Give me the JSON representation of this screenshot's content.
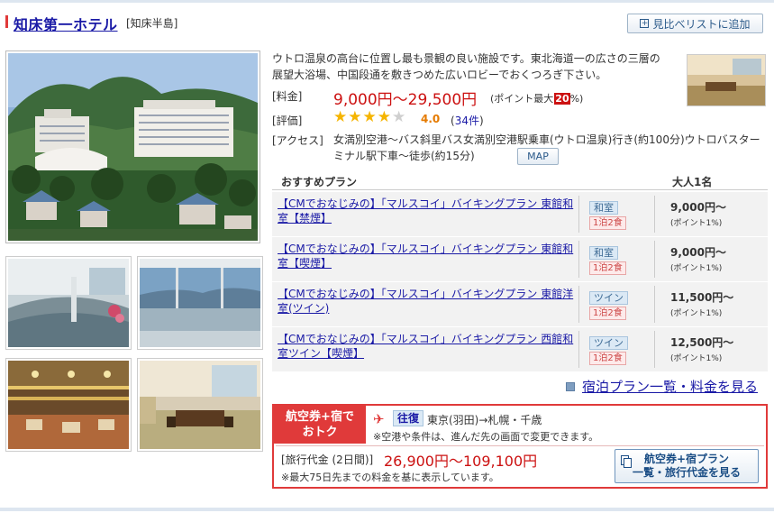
{
  "hotel": {
    "name": "知床第一ホテル",
    "region": "[知床半島]",
    "add_button": "見比べリストに追加",
    "add_button_icon": "plus-box-icon",
    "description": "ウトロ温泉の高台に位置し最も景観の良い施設です。東北海道一の広さの三層の展望大浴場、中国段通を敷きつめた広いロビーでおくつろぎ下さい。"
  },
  "info": {
    "price_label": "[料金]",
    "price": "9,000円〜29,500円",
    "points_prefix": "(ポイント最大",
    "points_value": "20",
    "points_suffix": "%)",
    "rating_label": "[評価]",
    "stars_filled": 4,
    "stars_total": 5,
    "rating": "4.0",
    "reviews": "34件",
    "reviews_open": "(",
    "reviews_close": ")",
    "access_label": "[アクセス]",
    "access": "女満別空港〜バス斜里バス女満別空港駅乗車(ウトロ温泉)行き(約100分)ウトロバスターミナル駅下車〜徒歩(約15分)",
    "map_button": "MAP"
  },
  "plans": {
    "header_plan": "おすすめプラン",
    "header_price": "大人1名",
    "rows": [
      {
        "name": "【CMでおなじみの】「マルスコイ」バイキングプラン 東館和室【禁煙】",
        "room": "和室",
        "meal": "1泊2食",
        "price": "9,000円〜",
        "point": "(ポイント1%)"
      },
      {
        "name": "【CMでおなじみの】「マルスコイ」バイキングプラン 東館和室【喫煙】",
        "room": "和室",
        "meal": "1泊2食",
        "price": "9,000円〜",
        "point": "(ポイント1%)"
      },
      {
        "name": "【CMでおなじみの】「マルスコイ」バイキングプラン 東館洋室(ツイン)",
        "room": "ツイン",
        "meal": "1泊2食",
        "price": "11,500円〜",
        "point": "(ポイント1%)"
      },
      {
        "name": "【CMでおなじみの】「マルスコイ」バイキングプラン 西館和室ツイン【喫煙】",
        "room": "ツイン",
        "meal": "1泊2食",
        "price": "12,500円〜",
        "point": "(ポイント1%)"
      }
    ],
    "all_link": "宿泊プラン一覧・料金を見る"
  },
  "air": {
    "badge_line1": "航空券+宿で",
    "badge_line2": "おトク",
    "roundtrip": "往復",
    "route": "東京(羽田)→札幌・千歳",
    "route_note": "※空港や条件は、進んだ先の画面で変更できます。",
    "tour_label": "[旅行代金 (2日間)]",
    "tour_price": "26,900円〜109,100円",
    "tour_note": "※最大75日先までの料金を基に表示しています。",
    "button_line1": "航空券+宿プラン",
    "button_line2": "一覧・旅行代金を見る"
  },
  "colors": {
    "accent_red": "#e03a3a",
    "price_red": "#cc1111",
    "link_blue": "#1a1aa6",
    "star_gold": "#f5b400"
  }
}
